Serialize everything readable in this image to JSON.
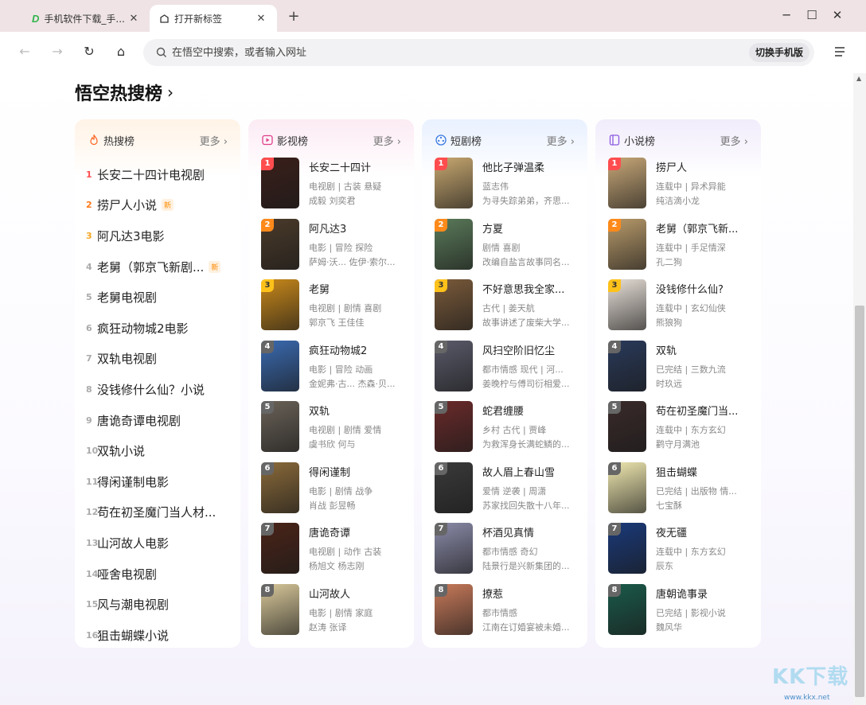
{
  "tabs": [
    {
      "title": "手机软件下载_手...",
      "close": "✕"
    },
    {
      "title": "打开新标签",
      "close": "✕"
    }
  ],
  "newtab": "+",
  "window": {
    "minimize": "─",
    "maximize": "☐",
    "close": "✕"
  },
  "toolbar": {
    "back": "←",
    "forward": "→",
    "reload": "↻",
    "home": "⌂",
    "address_placeholder": "在悟空中搜索，或者输入网址",
    "mobile_btn": "切换手机版"
  },
  "section": {
    "title": "悟空热搜榜",
    "chevron": "›"
  },
  "cards": {
    "hot": {
      "name": "热搜榜",
      "more": "更多 ›"
    },
    "tv": {
      "name": "影视榜",
      "more": "更多 ›"
    },
    "drama": {
      "name": "短剧榜",
      "more": "更多 ›"
    },
    "novel": {
      "name": "小说榜",
      "more": "更多 ›"
    }
  },
  "hot_list": [
    {
      "rank": "1",
      "text": "长安二十四计电视剧",
      "badge": ""
    },
    {
      "rank": "2",
      "text": "捞尸人小说",
      "badge": "新"
    },
    {
      "rank": "3",
      "text": "阿凡达3电影",
      "badge": ""
    },
    {
      "rank": "4",
      "text": "老舅（郭京飞新剧...",
      "badge": "新"
    },
    {
      "rank": "5",
      "text": "老舅电视剧",
      "badge": ""
    },
    {
      "rank": "6",
      "text": "疯狂动物城2电影",
      "badge": ""
    },
    {
      "rank": "7",
      "text": "双轨电视剧",
      "badge": ""
    },
    {
      "rank": "8",
      "text": "没钱修什么仙？小说",
      "badge": ""
    },
    {
      "rank": "9",
      "text": "唐诡奇谭电视剧",
      "badge": ""
    },
    {
      "rank": "10",
      "text": "双轨小说",
      "badge": ""
    },
    {
      "rank": "11",
      "text": "得闲谨制电影",
      "badge": ""
    },
    {
      "rank": "12",
      "text": "苟在初圣魔门当人材...",
      "badge": ""
    },
    {
      "rank": "13",
      "text": "山河故人电影",
      "badge": ""
    },
    {
      "rank": "14",
      "text": "哑舍电视剧",
      "badge": ""
    },
    {
      "rank": "15",
      "text": "风与潮电视剧",
      "badge": ""
    },
    {
      "rank": "16",
      "text": "狙击蝴蝶小说",
      "badge": ""
    }
  ],
  "tv_list": [
    {
      "rank": "1",
      "title": "长安二十四计",
      "tags": "电视剧 | 古装 悬疑",
      "desc": "成毅 刘奕君",
      "color": "#3a1f1a"
    },
    {
      "rank": "2",
      "title": "阿凡达3",
      "tags": "电影 | 冒险 探险",
      "desc": "萨姆·沃... 佐伊·索尔...",
      "color": "#4a3a2a"
    },
    {
      "rank": "3",
      "title": "老舅",
      "tags": "电视剧 | 剧情 喜剧",
      "desc": "郭京飞 王佳佳",
      "color": "#c8881a"
    },
    {
      "rank": "4",
      "title": "疯狂动物城2",
      "tags": "电影 | 冒险 动画",
      "desc": "金妮弗·古... 杰森·贝...",
      "color": "#3a6ab0"
    },
    {
      "rank": "5",
      "title": "双轨",
      "tags": "电视剧 | 剧情 爱情",
      "desc": "虞书欣 何与",
      "color": "#6a6258"
    },
    {
      "rank": "6",
      "title": "得闲谨制",
      "tags": "电影 | 剧情 战争",
      "desc": "肖战 彭昱畅",
      "color": "#8a6a3a"
    },
    {
      "rank": "7",
      "title": "唐诡奇谭",
      "tags": "电视剧 | 动作 古装",
      "desc": "杨旭文 杨志刚",
      "color": "#4a2418"
    },
    {
      "rank": "8",
      "title": "山河故人",
      "tags": "电影 | 剧情 家庭",
      "desc": "赵涛 张译",
      "color": "#d8c89a"
    }
  ],
  "drama_list": [
    {
      "rank": "1",
      "title": "他比子弹温柔",
      "tags": "蓝志伟",
      "desc": "为寻失踪弟弟，齐思...",
      "color": "#c8a870"
    },
    {
      "rank": "2",
      "title": "方夏",
      "tags": "剧情 喜剧",
      "desc": "改编自盐言故事同名...",
      "color": "#5a7a5a"
    },
    {
      "rank": "3",
      "title": "不好意思我全家...",
      "tags": "古代 | 姜天航",
      "desc": "故事讲述了废柴大学...",
      "color": "#7a5a3a"
    },
    {
      "rank": "4",
      "title": "风扫空阶旧忆尘",
      "tags": "都市情感 现代 | 河...",
      "desc": "姜晚柠与傅司衍相爱...",
      "color": "#5a5a6a"
    },
    {
      "rank": "5",
      "title": "蛇君缠腰",
      "tags": "乡村 古代 | 贾峰",
      "desc": "为救浑身长满蛇鳞的...",
      "color": "#6a2a2a"
    },
    {
      "rank": "6",
      "title": "故人眉上春山雪",
      "tags": "爱情 逆袭 | 周潇",
      "desc": "苏家找回失散十八年...",
      "color": "#3a3a3a"
    },
    {
      "rank": "7",
      "title": "杯酒见真情",
      "tags": "都市情感 奇幻",
      "desc": "陆景行是兴新集团的...",
      "color": "#8a8aa8"
    },
    {
      "rank": "8",
      "title": "撩惹",
      "tags": "都市情感",
      "desc": "江南在订婚宴被未婚...",
      "color": "#c87a5a"
    }
  ],
  "novel_list": [
    {
      "rank": "1",
      "title": "捞尸人",
      "tags": "连载中 | 异术异能",
      "desc": "纯洁滴小龙",
      "color": "#c8a878"
    },
    {
      "rank": "2",
      "title": "老舅（郭京飞新...",
      "tags": "连载中 | 手足情深",
      "desc": "孔二狗",
      "color": "#b89a6a"
    },
    {
      "rank": "3",
      "title": "没钱修什么仙?",
      "tags": "连载中 | 玄幻仙侠",
      "desc": "熊狼狗",
      "color": "#e8e0d8"
    },
    {
      "rank": "4",
      "title": "双轨",
      "tags": "已完结 | 三数九流",
      "desc": "时玖远",
      "color": "#2a3a5a"
    },
    {
      "rank": "5",
      "title": "苟在初圣魔门当...",
      "tags": "连载中 | 东方玄幻",
      "desc": "鹳守月满池",
      "color": "#3a2a2a"
    },
    {
      "rank": "6",
      "title": "狙击蝴蝶",
      "tags": "已完结 | 出版物 情...",
      "desc": "七宝酥",
      "color": "#f0e8b0"
    },
    {
      "rank": "7",
      "title": "夜无疆",
      "tags": "连载中 | 东方玄幻",
      "desc": "辰东",
      "color": "#1a3a7a"
    },
    {
      "rank": "8",
      "title": "唐朝诡事录",
      "tags": "已完结 | 影视小说",
      "desc": "魏风华",
      "color": "#1a5a4a"
    }
  ],
  "watermark": {
    "main": "KK下载",
    "sub": "www.kkx.net"
  }
}
